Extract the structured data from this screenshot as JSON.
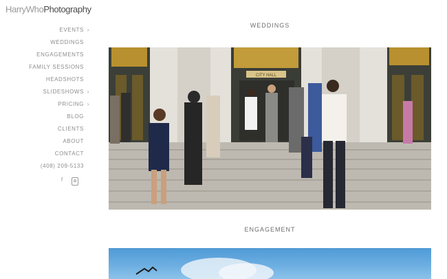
{
  "brand": {
    "logo_light": "HarryWho",
    "logo_dark": "Photography"
  },
  "nav": {
    "items": [
      {
        "label": "EVENTS",
        "caret": "›"
      },
      {
        "label": "WEDDINGS",
        "caret": ""
      },
      {
        "label": "ENGAGEMENTS",
        "caret": ""
      },
      {
        "label": "FAMILY SESSIONS",
        "caret": ""
      },
      {
        "label": "HEADSHOTS",
        "caret": ""
      },
      {
        "label": "SLIDESHOWS",
        "caret": "›"
      },
      {
        "label": "PRICING",
        "caret": "›"
      },
      {
        "label": "BLOG",
        "caret": ""
      },
      {
        "label": "CLIENTS",
        "caret": ""
      },
      {
        "label": "ABOUT",
        "caret": ""
      },
      {
        "label": "CONTACT",
        "caret": ""
      },
      {
        "label": "(408) 209-5133",
        "caret": ""
      }
    ]
  },
  "social": {
    "facebook_glyph": "f"
  },
  "sections": {
    "weddings_title": "WEDDINGS",
    "engagement_title": "ENGAGEMENT",
    "sign_text": "CITY HALL"
  },
  "colors": {
    "gold": "#b8902f",
    "stone": "#c9c6be",
    "sky": "#5fa6dd",
    "dress_white": "#f2f2f2"
  }
}
